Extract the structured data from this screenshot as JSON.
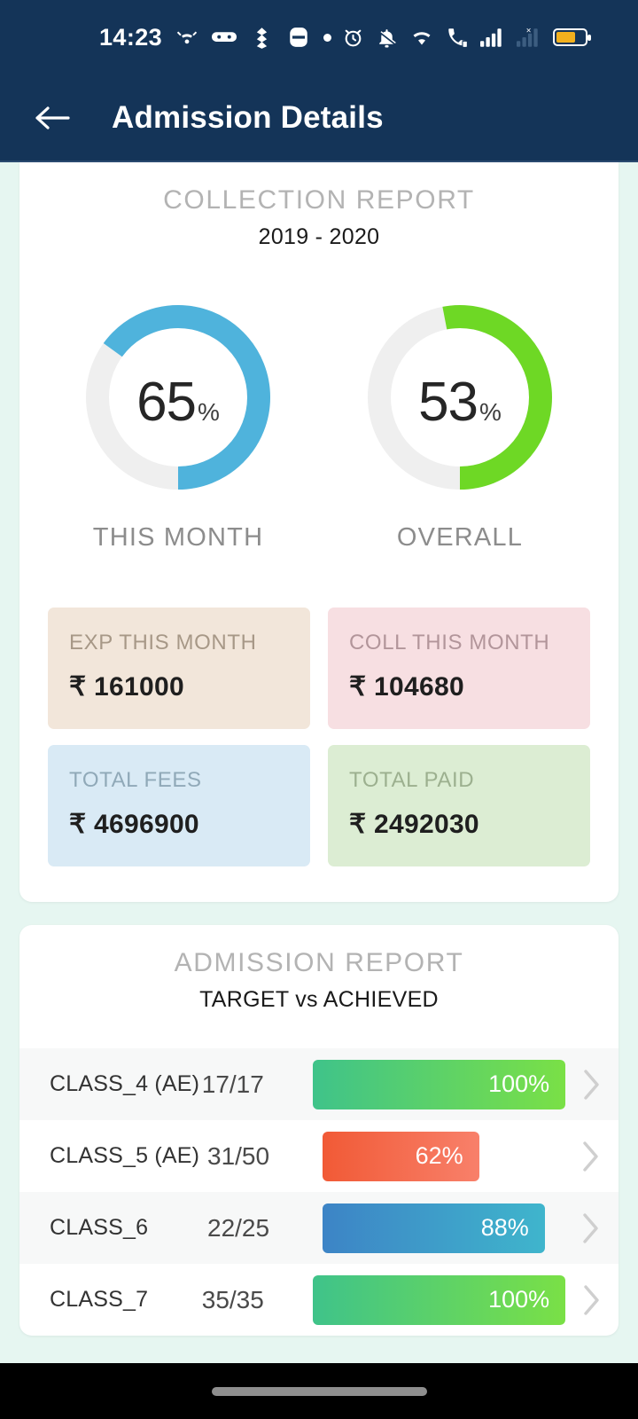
{
  "status_bar": {
    "time": "14:23",
    "left_icons": [
      "missed-call-icon",
      "glasses-icon",
      "leaf-icon",
      "card-icon",
      "dot-icon"
    ],
    "right_icons": [
      "alarm-icon",
      "bell-muted-icon",
      "wifi-icon",
      "wifi-calling-icon",
      "signal-bars-icon",
      "sim-missing-icon",
      "battery-icon"
    ],
    "battery_color": "#f2b01e"
  },
  "app_bar": {
    "back_label": "back-arrow",
    "title": "Admission Details",
    "background": "#143458"
  },
  "collection_report": {
    "title": "COLLECTION REPORT",
    "subtitle": "2019 - 2020",
    "gauges": [
      {
        "value": 65,
        "suffix": "%",
        "label": "THIS MONTH",
        "color": "#4fb3dc",
        "track": "#efefef"
      },
      {
        "value": 53,
        "suffix": "%",
        "label": "OVERALL",
        "color": "#6ed825",
        "track": "#efefef"
      }
    ],
    "tiles": [
      {
        "label": "EXP THIS MONTH",
        "value": "₹ 161000",
        "bg": "#f2e6da",
        "label_color": "#a79887"
      },
      {
        "label": "COLL THIS MONTH",
        "value": "₹ 104680",
        "bg": "#f7dfe2",
        "label_color": "#b2959a"
      },
      {
        "label": "TOTAL FEES",
        "value": "₹ 4696900",
        "bg": "#d9eaf5",
        "label_color": "#90a9b8"
      },
      {
        "label": "TOTAL PAID",
        "value": "₹ 2492030",
        "bg": "#dcedd3",
        "label_color": "#9cb08f"
      }
    ]
  },
  "admission_report": {
    "title": "ADMISSION REPORT",
    "subtitle": "TARGET vs ACHIEVED",
    "rows": [
      {
        "name": "CLASS_4 (AE)",
        "ratio": "17/17",
        "percent": "100%",
        "pct": 100,
        "grad_from": "#3fc38a",
        "grad_to": "#7ae046"
      },
      {
        "name": "CLASS_5 (AE)",
        "ratio": "31/50",
        "percent": "62%",
        "pct": 62,
        "grad_from": "#f15a36",
        "grad_to": "#f8806a"
      },
      {
        "name": "CLASS_6",
        "ratio": "22/25",
        "percent": "88%",
        "pct": 88,
        "grad_from": "#3d84c6",
        "grad_to": "#3fb5cc"
      },
      {
        "name": "CLASS_7",
        "ratio": "35/35",
        "percent": "100%",
        "pct": 100,
        "grad_from": "#3fc38a",
        "grad_to": "#7ae046"
      }
    ]
  },
  "nav_bar": {
    "home_indicator": "home-indicator"
  },
  "chart_data": [
    {
      "type": "pie",
      "title": "COLLECTION REPORT",
      "subtitle": "2019 - 2020",
      "labels": [
        "THIS MONTH",
        "OVERALL"
      ],
      "values": [
        65,
        53
      ],
      "unit": "%",
      "colors": [
        "#4fb3dc",
        "#6ed825"
      ],
      "style": "donut-gauge",
      "ylim": [
        0,
        100
      ]
    },
    {
      "type": "bar",
      "title": "ADMISSION REPORT",
      "subtitle": "TARGET vs ACHIEVED",
      "orientation": "horizontal",
      "categories": [
        "CLASS_4 (AE)",
        "CLASS_5 (AE)",
        "CLASS_6",
        "CLASS_7"
      ],
      "values": [
        100,
        62,
        88,
        100
      ],
      "ratios": [
        "17/17",
        "31/50",
        "22/25",
        "35/35"
      ],
      "achieved": [
        17,
        31,
        22,
        35
      ],
      "target": [
        17,
        50,
        25,
        35
      ],
      "xlabel": "",
      "ylabel": "",
      "xlim": [
        0,
        100
      ],
      "grid": false,
      "legend": false
    }
  ]
}
